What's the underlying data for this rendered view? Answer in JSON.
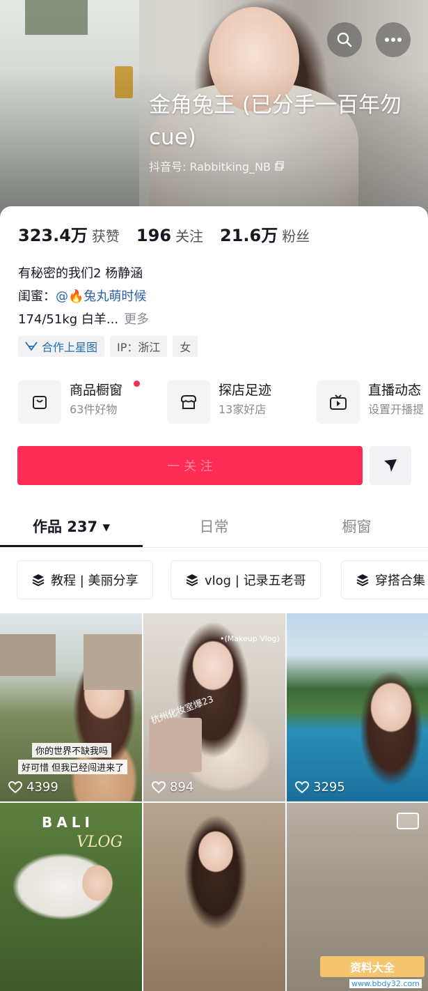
{
  "header": {
    "nickname": "金角兔王 (已分手一百年勿 cue)",
    "douyin_id": "抖音号: Rabbitking_NB",
    "search_icon": "search-icon",
    "more_icon": "more-dots-icon"
  },
  "stats": [
    {
      "value": "323.4万",
      "label": "获赞"
    },
    {
      "value": "196",
      "label": "关注"
    },
    {
      "value": "21.6万",
      "label": "粉丝"
    }
  ],
  "bio": {
    "line1": "有秘密的我们2 杨静涵",
    "bestie_label": "闺蜜：",
    "bestie_mention": "@🔥兔丸萌时候",
    "line3": "174/51kg 白羊...",
    "more": "更多"
  },
  "tags": [
    {
      "label": "合作上星图",
      "icon": "star-map-icon"
    },
    {
      "label": "IP：浙江"
    },
    {
      "label": "女"
    }
  ],
  "services": [
    {
      "title": "商品橱窗",
      "sub": "63件好物",
      "icon": "shopping-bag-icon",
      "has_dot": true
    },
    {
      "title": "探店足迹",
      "sub": "13家好店",
      "icon": "store-icon"
    },
    {
      "title": "直播动态",
      "sub": "设置开播提",
      "icon": "tv-icon"
    }
  ],
  "actions": {
    "follow_label": "一 关 注",
    "share_icon": "paper-plane-icon"
  },
  "tabs": [
    {
      "label": "作品 237 ▾",
      "active": true
    },
    {
      "label": "日常"
    },
    {
      "label": "橱窗"
    }
  ],
  "collections": [
    {
      "label": "教程 | 美丽分享",
      "icon": "layers-icon"
    },
    {
      "label": "vlog | 记录五老哥",
      "icon": "layers-icon"
    },
    {
      "label": "穿搭合集",
      "icon": "layers-icon"
    }
  ],
  "videos": [
    {
      "likes": "4399",
      "captions": [
        "你的世界不缺我吗",
        "好可惜 但我已经闯进来了"
      ]
    },
    {
      "likes": "894",
      "overlay_top": "•(Makeup Vlog)",
      "overlay_side": "杭州化妆室爆23"
    },
    {
      "likes": "3295"
    },
    {
      "title": "BALI",
      "subtitle": "VLOG"
    },
    {},
    {
      "watermark": "资料大全",
      "watermark_sub": "www.bbdy32.com"
    }
  ],
  "colors": {
    "accent": "#fe2c55",
    "mention": "#2d5fa8",
    "star_tag": "#1f6fb2"
  }
}
